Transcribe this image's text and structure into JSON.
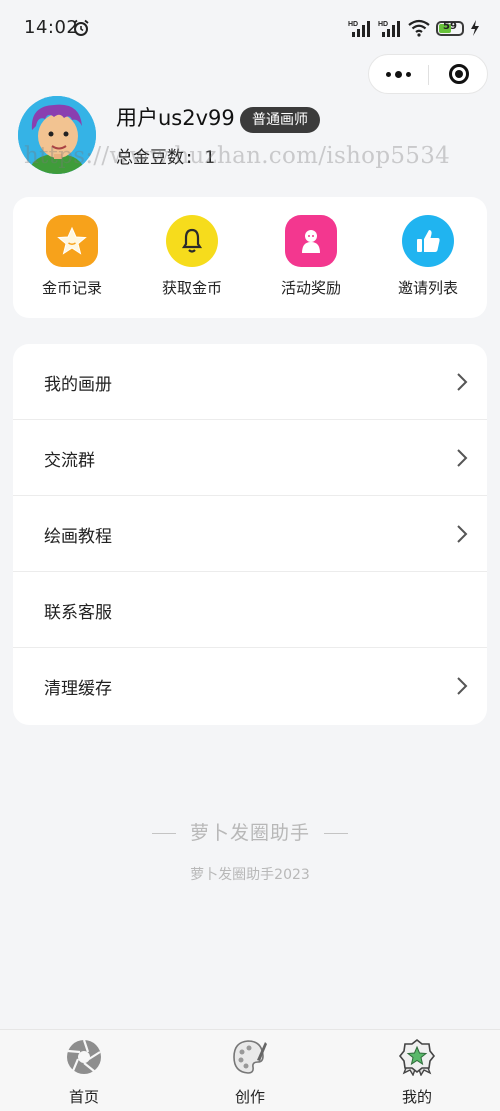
{
  "status_bar": {
    "time": "14:02",
    "battery_level": "59",
    "icons": [
      "alarm-icon",
      "signal-hd-icon",
      "signal-hd-icon",
      "wifi-icon",
      "battery-icon",
      "charging-icon"
    ]
  },
  "capsule": {
    "more_icon": "more-dots-icon",
    "close_icon": "target-icon"
  },
  "profile": {
    "username": "用户us2v99",
    "badge": "普通画师",
    "coin_label": "总金豆数:",
    "coin_value": "1",
    "watermark": "https://www.huzhan.com/ishop5534"
  },
  "actions": [
    {
      "label": "金币记录",
      "icon": "star-icon",
      "color": "#f7a21b"
    },
    {
      "label": "获取金币",
      "icon": "bell-icon",
      "color": "#f6dc1c"
    },
    {
      "label": "活动奖励",
      "icon": "mascot-icon",
      "color": "#f3378f"
    },
    {
      "label": "邀请列表",
      "icon": "thumbs-up-icon",
      "color": "#20b4f0"
    }
  ],
  "menu": [
    {
      "label": "我的画册",
      "chevron": true
    },
    {
      "label": "交流群",
      "chevron": true
    },
    {
      "label": "绘画教程",
      "chevron": true
    },
    {
      "label": "联系客服",
      "chevron": false
    },
    {
      "label": "清理缓存",
      "chevron": true
    }
  ],
  "footer": {
    "brand": "萝卜发圈助手",
    "copyright": "萝卜发圈助手2023"
  },
  "tabbar": [
    {
      "label": "首页",
      "icon": "aperture-icon"
    },
    {
      "label": "创作",
      "icon": "palette-icon"
    },
    {
      "label": "我的",
      "icon": "badge-icon"
    }
  ]
}
